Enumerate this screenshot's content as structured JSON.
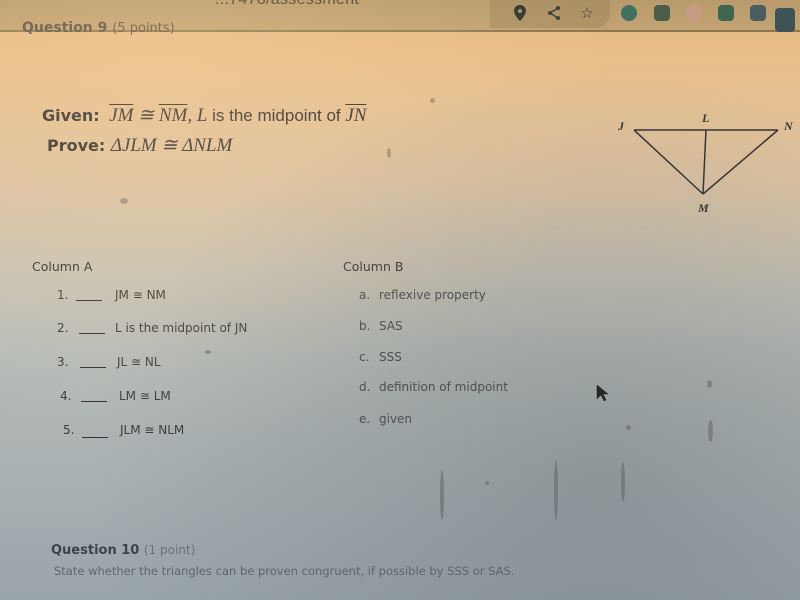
{
  "browser": {
    "url_fragment": "...7478/assessment",
    "toolbar_icons": [
      "location-pin-icon",
      "share-icon",
      "bookmark-star-icon"
    ],
    "extension_icons": [
      "extension-teal-icon",
      "extension-green-icon",
      "extension-pink-icon",
      "extension-person-icon",
      "extension-doc-icon",
      "extension-badge-icon"
    ]
  },
  "question9": {
    "title": "Question 9",
    "points": "(5 points)",
    "given_label": "Given:",
    "given_seg1": "JM",
    "given_cong": " ≅ ",
    "given_seg2": "NM",
    "given_rest": ", L",
    "given_text": " is the midpoint of ",
    "given_seg3": "JN",
    "prove_label": "Prove:",
    "prove_statement": "ΔJLM ≅ ΔNLM",
    "diagram": {
      "points": [
        "J",
        "L",
        "N",
        "M"
      ]
    },
    "column_a": {
      "title": "Column A",
      "items": [
        {
          "num": "1.",
          "statement": "JM ≅ NM"
        },
        {
          "num": "2.",
          "statement": "L is the midpoint of JN"
        },
        {
          "num": "3.",
          "statement": "JL ≅ NL"
        },
        {
          "num": "4.",
          "statement": "LM ≅ LM"
        },
        {
          "num": "5.",
          "statement": "JLM ≅ NLM"
        }
      ]
    },
    "column_b": {
      "title": "Column B",
      "items": [
        {
          "letter": "a.",
          "reason": "reflexive property"
        },
        {
          "letter": "b.",
          "reason": "SAS"
        },
        {
          "letter": "c.",
          "reason": "SSS"
        },
        {
          "letter": "d.",
          "reason": "definition of midpoint"
        },
        {
          "letter": "e.",
          "reason": "given"
        }
      ]
    }
  },
  "question10": {
    "title": "Question 10",
    "points": "(1 point)",
    "prompt": "State whether the triangles can be proven congruent, if possible by SSS or SAS."
  }
}
